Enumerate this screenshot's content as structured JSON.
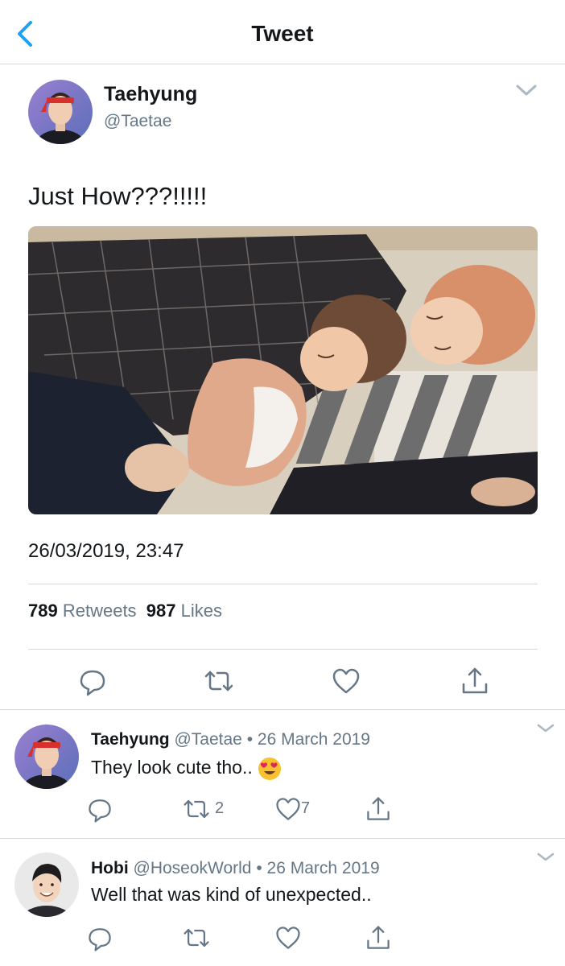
{
  "header": {
    "title": "Tweet"
  },
  "main_tweet": {
    "author": {
      "name": "Taehyung",
      "handle": "@Taetae"
    },
    "text": "Just How???!!!!!",
    "timestamp": "26/03/2019, 23:47",
    "stats": {
      "retweets_count": "789",
      "retweets_label": "Retweets",
      "likes_count": "987",
      "likes_label": "Likes"
    }
  },
  "replies": [
    {
      "name": "Taehyung",
      "handle": "@Taetae",
      "separator": "•",
      "date": "26 March 2019",
      "text": "They look cute tho..",
      "emoji": "heart-eyes-emoji",
      "retweets": "2",
      "likes": "7"
    },
    {
      "name": "Hobi",
      "handle": "@HoseokWorld",
      "separator": "•",
      "date": "26 March 2019",
      "text": "Well that was kind of unexpected.."
    }
  ],
  "colors": {
    "accent": "#1da1f2",
    "text": "#14171a",
    "secondary_text": "#657786",
    "divider": "#d6d9dc",
    "emoji_face": "#f7c12f",
    "emoji_heart": "#e0245e"
  }
}
